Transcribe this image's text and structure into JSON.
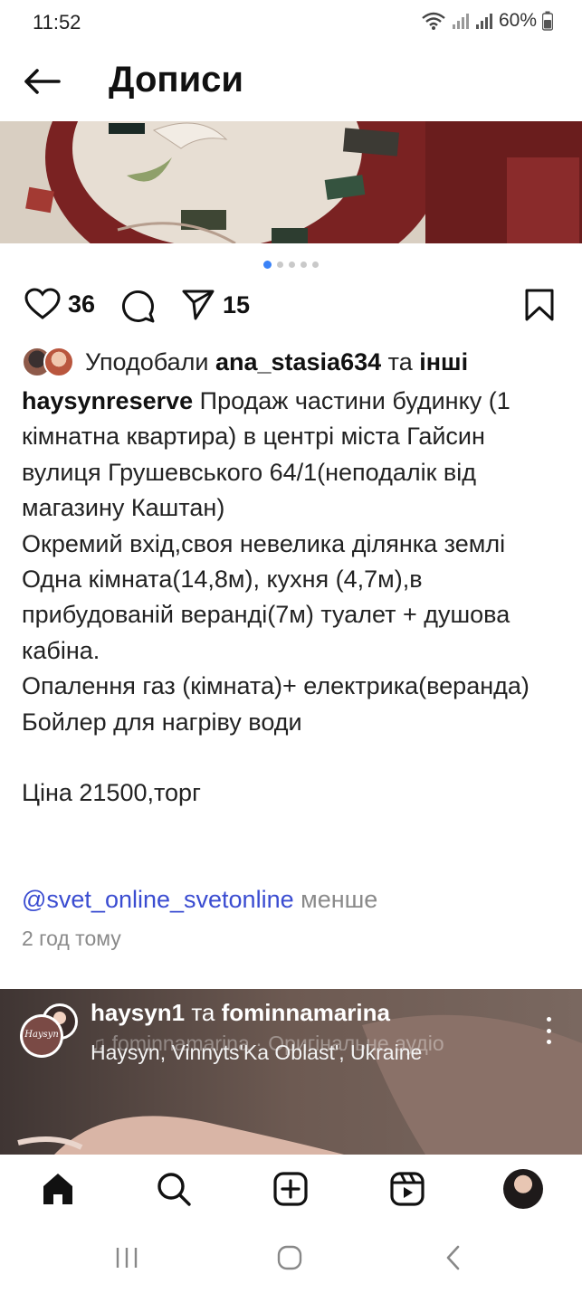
{
  "status_bar": {
    "time": "11:52",
    "battery": "60%"
  },
  "header": {
    "title": "Дописи"
  },
  "post": {
    "likes_count": "36",
    "shares_count": "15",
    "liked_by_prefix": "Уподобали",
    "liked_by_user": "ana_stasia634",
    "liked_by_conj": "та",
    "liked_by_others": "інші",
    "author": "haysynreserve",
    "caption_text": " Продаж частини будинку (1 кімнатна квартира) в центрі міста Гайсин вулиця Грушевського 64/1(неподалік від магазину Каштан)\nОкремий вхід,своя невелика ділянка землі\nОдна кімната(14,8м), кухня (4,7м),в прибудованій веранді(7м) туалет + душова кабіна.\nОпалення газ (кімната)+ електрика(веранда)\nБойлер для нагріву води\n\nЦіна 21500,торг",
    "mention": "@svet_online_svetonline",
    "less_label": "менше",
    "time_ago": "2 год тому",
    "carousel_total": 5,
    "carousel_index": 1
  },
  "next_post": {
    "user1": "haysyn1",
    "conj": "та",
    "user2": "fominnamarina",
    "audio_ghost": "♫ fominnamarina · Оригінальне аудіо",
    "location": "Haysyn, Vinnyts'Ka Oblast', Ukraine",
    "avatar_text": "Haysyn"
  },
  "icons": {
    "back": "arrow-left-icon",
    "like": "heart-icon",
    "comment": "comment-icon",
    "share": "send-icon",
    "save": "bookmark-icon",
    "home": "home-icon",
    "search": "search-icon",
    "create": "plus-square-icon",
    "reels": "reels-icon",
    "profile": "profile-avatar"
  },
  "colors": {
    "mention": "#3a4cd1",
    "carousel_active": "#3a82f7",
    "muted_text": "#8a8a8a"
  }
}
